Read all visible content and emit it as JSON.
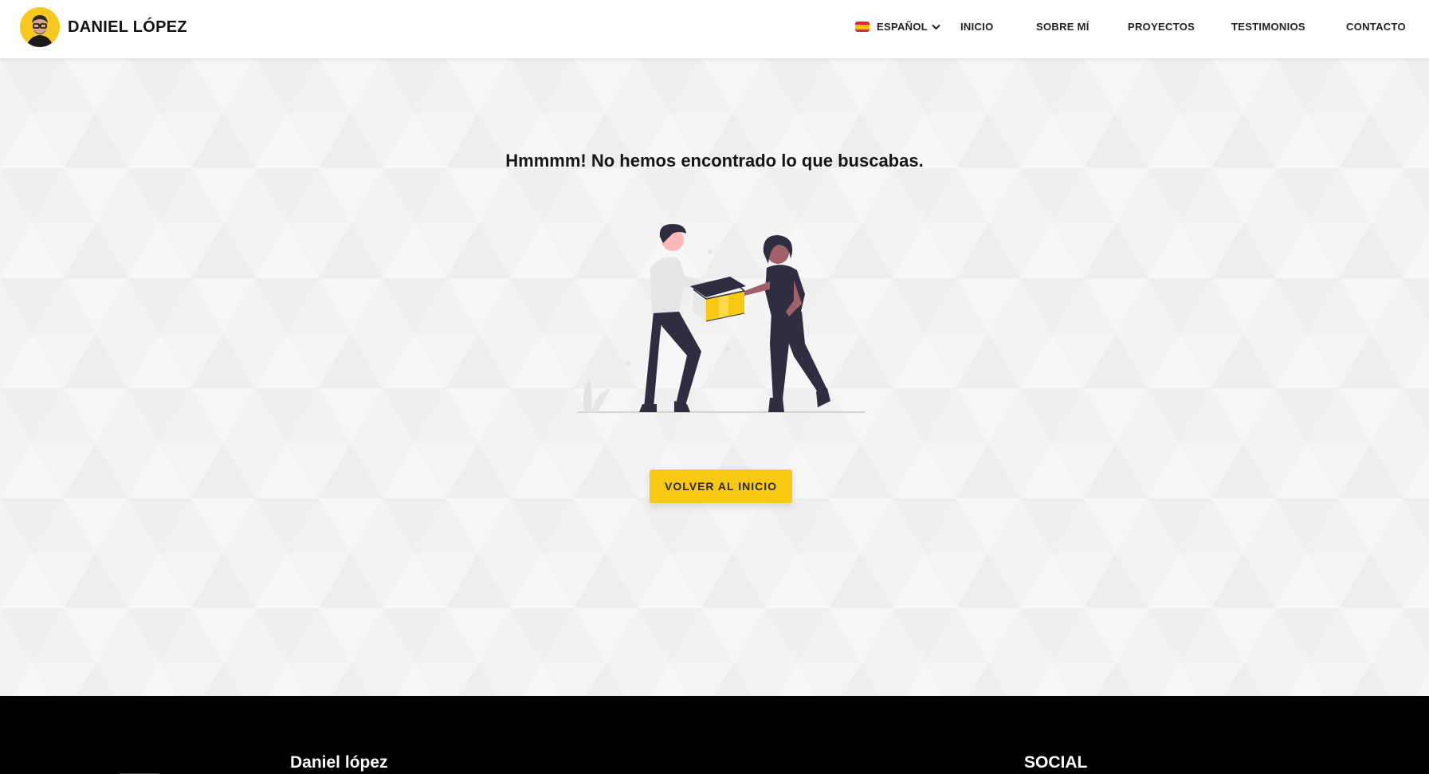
{
  "header": {
    "brand_name": "DANIEL LÓPEZ",
    "language": "ESPAÑOL",
    "nav": [
      "INICIO",
      "SOBRE MÍ",
      "PROYECTOS",
      "TESTIMONIOS",
      "CONTACTO"
    ]
  },
  "main": {
    "title": "Hmmmm! No hemos encontrado lo que buscabas.",
    "button_label": "VOLVER AL INICIO"
  },
  "footer": {
    "brand": "Daniel lópez",
    "social_heading": "SOCIAL"
  },
  "colors": {
    "accent": "#f8c912",
    "dark_figure": "#2f2e41",
    "footer_bg": "#000000",
    "header_bg": "#ffffff"
  },
  "icons": {
    "language_flag": "spain-flag-icon",
    "language_dropdown": "chevron-down-icon"
  }
}
